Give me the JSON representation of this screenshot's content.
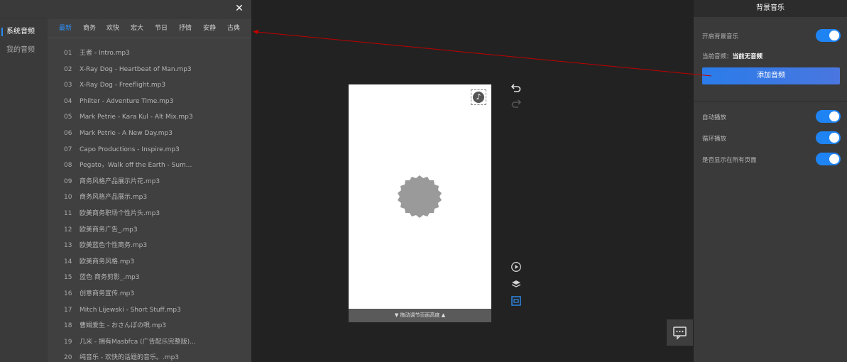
{
  "library": {
    "close_icon": "close-icon",
    "side_items": [
      {
        "label": "系统音频",
        "active": true
      },
      {
        "label": "我的音频",
        "active": false
      }
    ],
    "tabs": [
      {
        "label": "最新",
        "active": true
      },
      {
        "label": "商务",
        "active": false
      },
      {
        "label": "欢快",
        "active": false
      },
      {
        "label": "宏大",
        "active": false
      },
      {
        "label": "节日",
        "active": false
      },
      {
        "label": "抒情",
        "active": false
      },
      {
        "label": "安静",
        "active": false
      },
      {
        "label": "古典",
        "active": false
      }
    ],
    "tracks": [
      {
        "num": "01",
        "name": "王者 - Intro.mp3"
      },
      {
        "num": "02",
        "name": "X-Ray Dog - Heartbeat of Man.mp3"
      },
      {
        "num": "03",
        "name": "X-Ray Dog - Freeflight.mp3"
      },
      {
        "num": "04",
        "name": "Philter - Adventure Time.mp3"
      },
      {
        "num": "05",
        "name": "Mark Petrie - Kara Kul - Alt Mix.mp3"
      },
      {
        "num": "06",
        "name": "Mark Petrie - A New Day.mp3"
      },
      {
        "num": "07",
        "name": "Capo Productions - Inspire.mp3"
      },
      {
        "num": "08",
        "name": "Pegato，Walk off the Earth - Sum..."
      },
      {
        "num": "09",
        "name": "商务风格产品展示片花.mp3"
      },
      {
        "num": "10",
        "name": "商务风格产品展示.mp3"
      },
      {
        "num": "11",
        "name": "欧美商务职场个性片头.mp3"
      },
      {
        "num": "12",
        "name": "欧美商务广告_.mp3"
      },
      {
        "num": "13",
        "name": "欧美蓝色个性商务.mp3"
      },
      {
        "num": "14",
        "name": "欧美商务风格.mp3"
      },
      {
        "num": "15",
        "name": "蓝色 商务剪影_.mp3"
      },
      {
        "num": "16",
        "name": "创意商务宣传.mp3"
      },
      {
        "num": "17",
        "name": "Mitch Lijewski - Short Stuff.mp3"
      },
      {
        "num": "18",
        "name": "曹娟爱生 - おさんぽの唄.mp3"
      },
      {
        "num": "19",
        "name": "几米 - 拥有Masbfca (广告配乐完整版)..."
      },
      {
        "num": "20",
        "name": "纯音乐 - 欢快的话题的音乐。.mp3"
      }
    ]
  },
  "canvas": {
    "music_icon": "music-note-icon",
    "drag_bar_label": "▼ 拖动调节页面高度 ▲",
    "tools": {
      "undo_icon": "undo-icon",
      "redo_icon": "redo-icon",
      "play_icon": "play-icon",
      "layers_icon": "layers-icon",
      "preview_icon": "preview-icon"
    },
    "chat_icon": "chat-icon"
  },
  "bgm": {
    "title": "背景音乐",
    "enable_label": "开启背景音乐",
    "current_prefix": "当前音频：",
    "current_value": "当前无音频",
    "add_button": "添加音频",
    "autoplay_label": "自动播放",
    "loop_label": "循环播放",
    "all_pages_label": "是否显示在所有页面",
    "accent_color": "#1f84f3"
  }
}
